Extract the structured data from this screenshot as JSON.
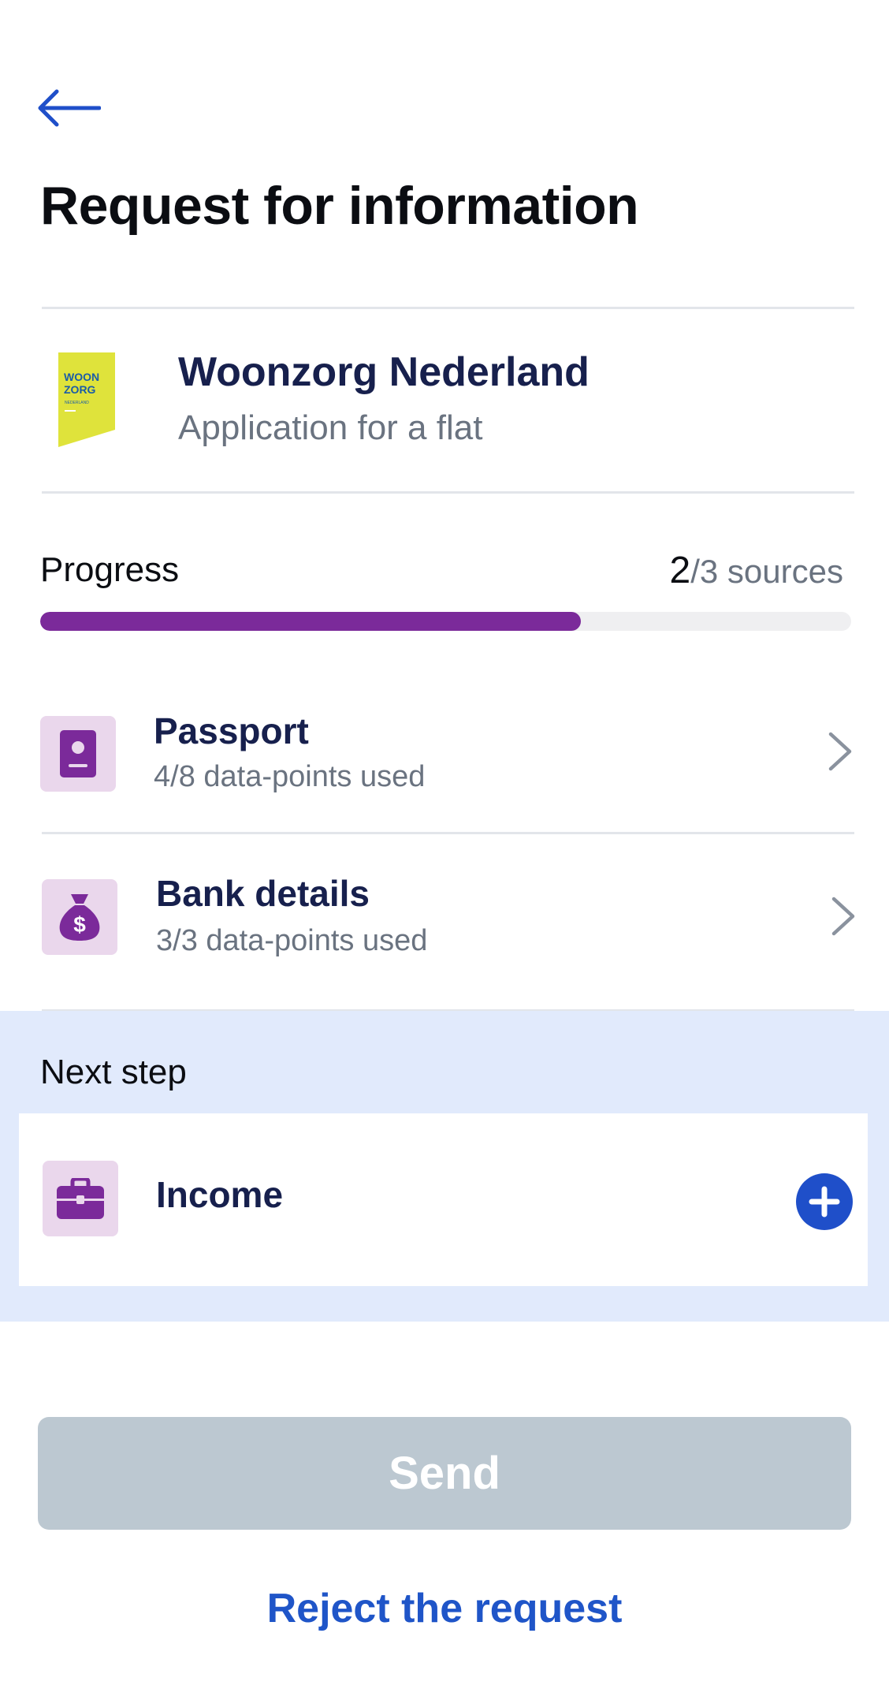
{
  "header": {
    "back_icon": "arrow-left-icon",
    "title": "Request for information"
  },
  "organization": {
    "logo": {
      "line1": "WOON",
      "line2": "ZORG",
      "line3": "NEDERLAND"
    },
    "name": "Woonzorg Nederland",
    "subtitle": "Application for a flat"
  },
  "progress": {
    "label": "Progress",
    "done": "2",
    "total_text": "/3 sources",
    "fraction": 0.6667,
    "color": "#7b2a9a"
  },
  "sources": [
    {
      "icon": "passport-icon",
      "title": "Passport",
      "subtitle": "4/8 data-points used"
    },
    {
      "icon": "money-bag-icon",
      "title": "Bank details",
      "subtitle": "3/3 data-points used"
    }
  ],
  "next_step": {
    "label": "Next step",
    "item": {
      "icon": "briefcase-icon",
      "title": "Income",
      "action_icon": "plus-circle-icon"
    }
  },
  "actions": {
    "send_label": "Send",
    "reject_label": "Reject the request"
  },
  "colors": {
    "accent": "#1f4fc9",
    "navy": "#17204d",
    "purple": "#7b2a9a",
    "icon_bg": "#ead7ec",
    "next_bg": "#e1eafc",
    "disabled_button": "#bcc8d1",
    "logo_yellow": "#dfe33b"
  }
}
